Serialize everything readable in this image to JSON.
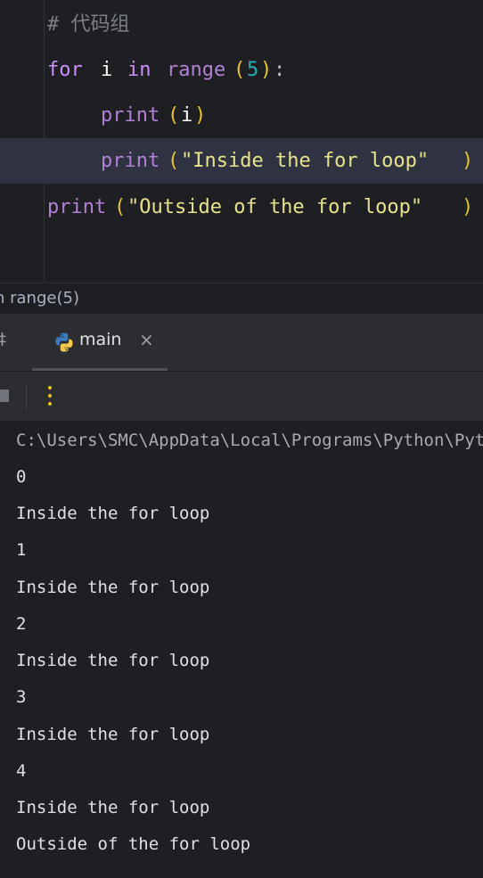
{
  "editor": {
    "lines": [
      {
        "comment": "# 代码组"
      },
      {
        "kw_for": "for",
        "var": "i",
        "kw_in": "in",
        "fn": "range",
        "paren_open": "(",
        "num": "5",
        "paren_close": ")",
        "colon": ":"
      },
      {
        "fn": "print",
        "paren_open": "(",
        "var": "i",
        "paren_close": ")"
      },
      {
        "fn": "print",
        "paren_open": "(",
        "str": "\"Inside the for loop\"",
        "paren_close": ")"
      },
      {
        "fn": "print",
        "paren_open": "(",
        "str": "\"Outside of the for loop\"",
        "paren_close": ")"
      }
    ],
    "current_line": 4
  },
  "breadcrumb": {
    "text": "n range(5)"
  },
  "run_panel": {
    "prev_tab_fragment": "‡",
    "tab": {
      "label": "main",
      "icon": "python-icon",
      "close_glyph": "×"
    },
    "toolbar": {
      "stop_icon": "stop-icon",
      "more_icon": "more-vertical-icon"
    }
  },
  "console": {
    "lines": [
      "C:\\Users\\SMC\\AppData\\Local\\Programs\\Python\\Python",
      "0",
      "Inside the for loop",
      "1",
      "Inside the for loop",
      "2",
      "Inside the for loop",
      "3",
      "Inside the for loop",
      "4",
      "Inside the for loop",
      "Outside of the for loop"
    ]
  },
  "colors": {
    "background": "#1e1f22",
    "panel": "#2b2d30",
    "keyword": "#cf8dfb",
    "function": "#b180d7",
    "string": "#e8e38b",
    "number": "#2aacb8",
    "paren": "#e8c32b",
    "comment": "#7a7e85"
  }
}
